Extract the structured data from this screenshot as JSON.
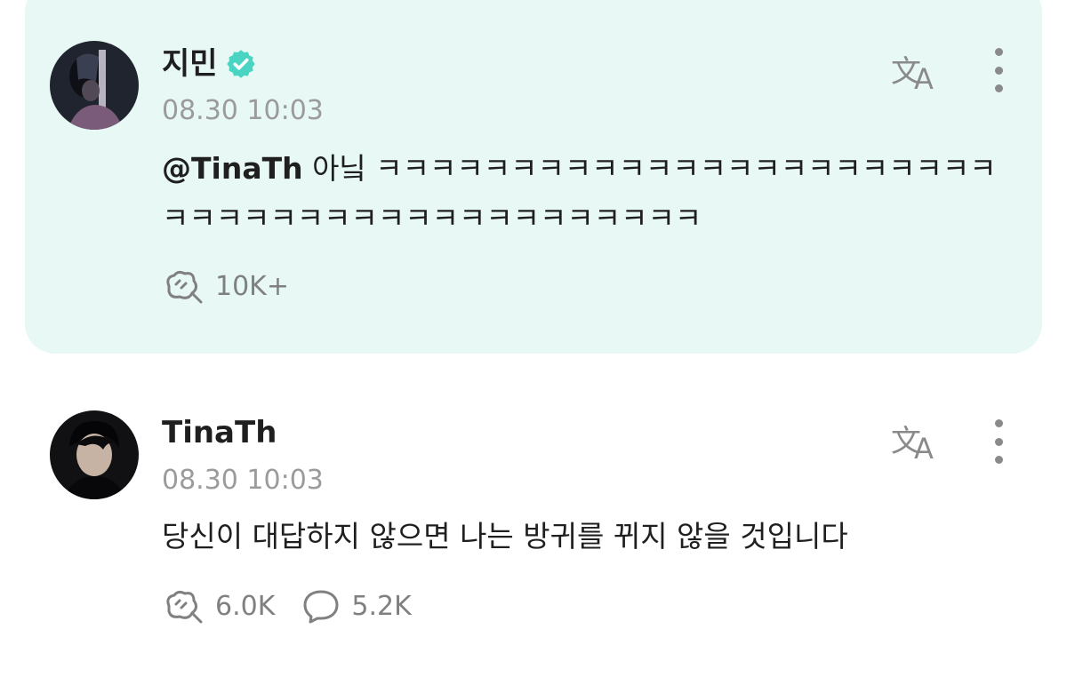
{
  "colors": {
    "highlight_background": "#e7f8f5",
    "verified_badge": "#49d4c4",
    "text_primary": "#1f1f1f",
    "text_secondary": "#9b9b9b",
    "icon_gray": "#808080"
  },
  "posts": [
    {
      "author": "지민",
      "verified": true,
      "timestamp": "08.30 10:03",
      "mention": "@TinaTh",
      "text": " 아닠 ㅋㅋㅋㅋㅋㅋㅋㅋㅋㅋㅋㅋㅋㅋㅋㅋㅋㅋㅋㅋㅋㅋㅋㅋㅋㅋㅋㅋㅋㅋㅋㅋㅋㅋㅋㅋㅋㅋㅋㅋㅋㅋㅋ",
      "likes": "10K+",
      "icons": [
        "avatar",
        "verified-badge-icon",
        "translate-icon",
        "more-options-icon",
        "like-icon"
      ]
    },
    {
      "author": "TinaTh",
      "verified": false,
      "timestamp": "08.30 10:03",
      "text": "당신이 대답하지 않으면 나는 방귀를 뀌지 않을 것입니다",
      "likes": "6.0K",
      "comments": "5.2K",
      "icons": [
        "avatar",
        "translate-icon",
        "more-options-icon",
        "like-icon",
        "comment-icon"
      ]
    }
  ]
}
